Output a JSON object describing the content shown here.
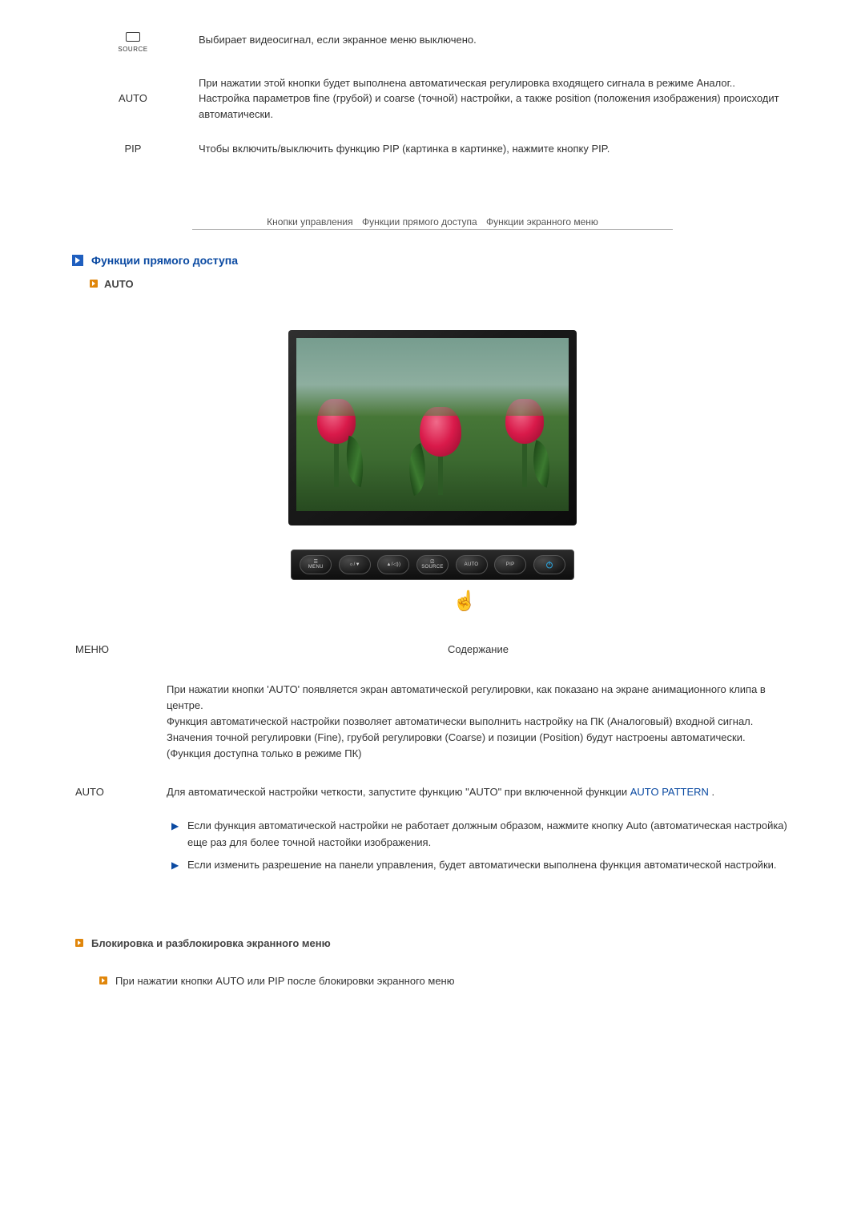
{
  "topButtons": {
    "source": {
      "label": "SOURCE",
      "desc": "Выбирает видеосигнал, если экранное меню выключено."
    },
    "auto": {
      "label": "AUTO",
      "desc": "При нажатии этой кнопки будет выполнена автоматическая регулировка входящего сигнала в режиме Аналог.. Настройка параметров fine (грубой) и coarse (точной) настройки, а также position (положения изображения) происходит автоматически."
    },
    "pip": {
      "label": "PIP",
      "desc": "Чтобы включить/выключить функцию PIP (картинка в картинке), нажмите кнопку PIP."
    }
  },
  "crumbs": {
    "a": "Кнопки управления",
    "b": "Функции прямого доступа",
    "c": "Функции экранного меню"
  },
  "section": {
    "title": "Функции прямого доступа",
    "sub": "AUTO"
  },
  "hwButtons": {
    "menu": "MENU",
    "bc": "☼/▼",
    "vol": "▲/◁))",
    "source": "SOURCE",
    "auto": "AUTO",
    "pip": "PIP"
  },
  "contentTable": {
    "head_menu": "МЕНЮ",
    "head_content": "Содержание",
    "row_label": "AUTO",
    "para1": "При нажатии кнопки 'AUTO' появляется экран автоматической регулировки, как показано на экране анимационного клипа в центре.\nФункция автоматической настройки позволяет автоматически выполнить настройку на ПК (Аналоговый) входной сигнал. Значения точной регулировки (Fine), грубой регулировки (Coarse) и позиции (Position) будут настроены автоматически.\n(Функция доступна только в режиме ПК)",
    "para2_a": "Для автоматической настройки четкости, запустите функцию \"AUTO\" при включенной функции ",
    "para2_link": "AUTO PATTERN",
    "para2_b": " .",
    "bullets": [
      "Если функция автоматической настройки не работает должным образом, нажмите кнопку Auto (автоматическая настройка) еще раз для более точной настойки изображения.",
      "Если изменить разрешение на панели управления, будет автоматически выполнена функция автоматической настройки."
    ]
  },
  "lock": {
    "title": "Блокировка и разблокировка экранного меню",
    "step1": "При нажатии кнопки AUTO или PIP после блокировки экранного меню"
  }
}
